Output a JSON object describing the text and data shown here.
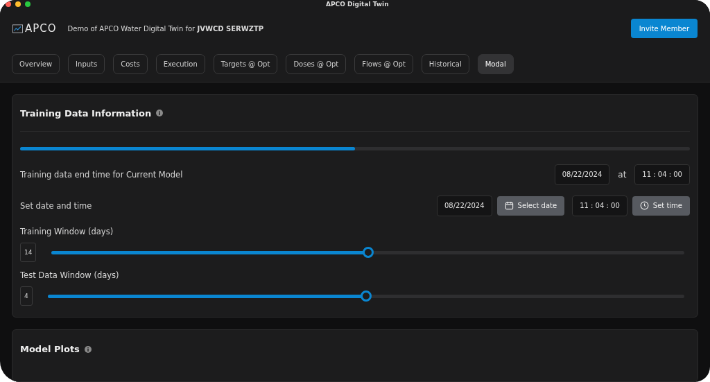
{
  "window": {
    "title": "APCO Digital Twin"
  },
  "header": {
    "logo": "APCO",
    "subtitle": "Demo of APCO Water Digital Twin for **JVWCD SERWZTP**",
    "invite_button": "Invite Member"
  },
  "tabs": [
    {
      "label": "Overview",
      "selected": false
    },
    {
      "label": "Inputs",
      "selected": false
    },
    {
      "label": "Costs",
      "selected": false
    },
    {
      "label": "Execution",
      "selected": false
    },
    {
      "label": "Targets @ Opt",
      "selected": false
    },
    {
      "label": "Doses @ Opt",
      "selected": false
    },
    {
      "label": "Flows @ Opt",
      "selected": false
    },
    {
      "label": "Historical",
      "selected": false
    },
    {
      "label": "Modal",
      "selected": true
    }
  ],
  "training_card": {
    "title": "Training Data Information",
    "progress": {
      "level": 0.5
    },
    "end_time": {
      "label": "Training data end time for Current Model",
      "date": "08/22/2024",
      "at": "at",
      "time": "11 : 04 : 00"
    },
    "set_time": {
      "label": "Set date and time",
      "date": "08/22/2024",
      "select_date_button": "Select date",
      "time": "11 : 04 : 00",
      "set_time_button": "Set time"
    },
    "sliders": [
      {
        "label": "Training Window (days)",
        "value": "14",
        "level": 0.5
      },
      {
        "label": "Test Data Window (days)",
        "value": "4",
        "level": 0.5
      }
    ]
  },
  "plots_card": {
    "title": "Model Plots"
  }
}
